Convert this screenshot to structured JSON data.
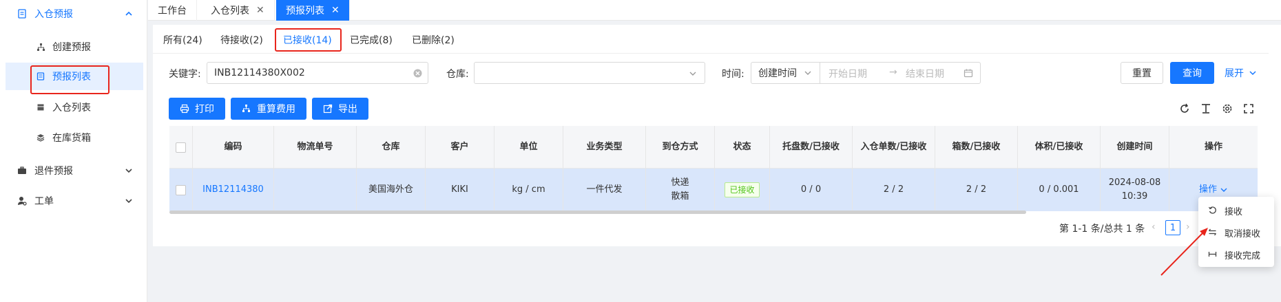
{
  "sidebar": {
    "groups": [
      {
        "label": "入仓预报",
        "icon": "document-icon"
      },
      {
        "label": "退件预报",
        "icon": "briefcase-icon"
      },
      {
        "label": "工单",
        "icon": "user-gear-icon"
      }
    ],
    "items": [
      {
        "label": "创建预报",
        "icon": "network-icon"
      },
      {
        "label": "预报列表",
        "icon": "list-icon"
      },
      {
        "label": "入仓列表",
        "icon": "box-icon"
      },
      {
        "label": "在库货箱",
        "icon": "layers-icon"
      }
    ]
  },
  "tabs": [
    {
      "label": "工作台"
    },
    {
      "label": "入仓列表"
    },
    {
      "label": "预报列表"
    }
  ],
  "status_tabs": [
    {
      "label": "所有(24)"
    },
    {
      "label": "待接收(2)"
    },
    {
      "label": "已接收(14)"
    },
    {
      "label": "已完成(8)"
    },
    {
      "label": "已删除(2)"
    }
  ],
  "filters": {
    "keyword_label": "关键字:",
    "keyword_value": "INB12114380X002",
    "warehouse_label": "仓库:",
    "time_label": "时间:",
    "time_type": "创建时间",
    "start_placeholder": "开始日期",
    "end_placeholder": "结束日期",
    "arrow": "→"
  },
  "actions": {
    "reset": "重置",
    "query": "查询",
    "expand": "展开"
  },
  "toolbar": {
    "print": "打印",
    "recalc": "重算费用",
    "export": "导出"
  },
  "table": {
    "headers": [
      "编码",
      "物流单号",
      "仓库",
      "客户",
      "单位",
      "业务类型",
      "到仓方式",
      "状态",
      "托盘数/已接收",
      "入仓单数/已接收",
      "箱数/已接收",
      "体积/已接收",
      "创建时间",
      "操作"
    ],
    "row": {
      "code": "INB12114380",
      "tracking": "",
      "warehouse": "美国海外仓",
      "customer": "KIKI",
      "unit": "kg / cm",
      "business_type": "一件代发",
      "arrival_line1": "快递",
      "arrival_line2": "散箱",
      "status": "已接收",
      "pallets": "0 / 0",
      "orders": "2 / 2",
      "boxes": "2 / 2",
      "volume": "0 / 0.001",
      "created_date": "2024-08-08",
      "created_time": "10:39",
      "op_label": "操作"
    }
  },
  "pagination": {
    "summary": "第 1-1 条/总共 1 条",
    "page": "1"
  },
  "dropdown": [
    {
      "label": "接收",
      "icon": "undo-icon"
    },
    {
      "label": "取消接收",
      "icon": "swap-icon"
    },
    {
      "label": "接收完成",
      "icon": "range-icon"
    }
  ],
  "colors": {
    "primary": "#1677ff",
    "highlight": "#e8251c",
    "row_selected": "#d9e6fb",
    "status_green": "#52c41a"
  }
}
